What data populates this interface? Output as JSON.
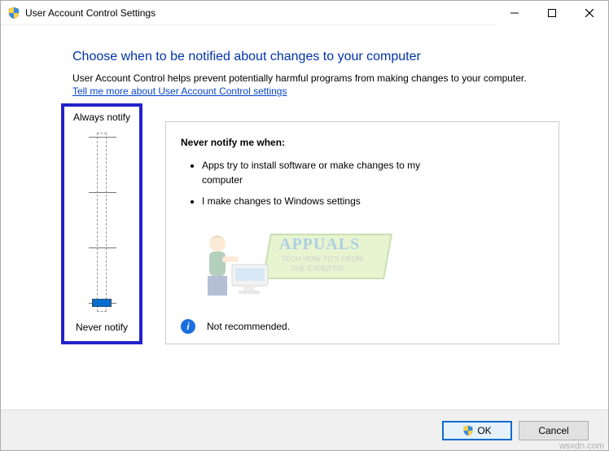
{
  "window": {
    "title": "User Account Control Settings"
  },
  "content": {
    "heading": "Choose when to be notified about changes to your computer",
    "subheading": "User Account Control helps prevent potentially harmful programs from making changes to your computer.",
    "help_link": "Tell me more about User Account Control settings"
  },
  "slider": {
    "top_label": "Always notify",
    "bottom_label": "Never notify",
    "levels": 4,
    "current_level": 0
  },
  "panel": {
    "title": "Never notify me when:",
    "items": [
      "Apps try to install software or make changes to my computer",
      "I make changes to Windows settings"
    ],
    "recommendation": "Not recommended."
  },
  "footer": {
    "ok": "OK",
    "cancel": "Cancel"
  },
  "watermark": {
    "brand": "APPUALS",
    "line1": "TECH HOW-TO'S FROM",
    "line2": "THE EXPERTS!",
    "site": "wsxdn.com"
  }
}
